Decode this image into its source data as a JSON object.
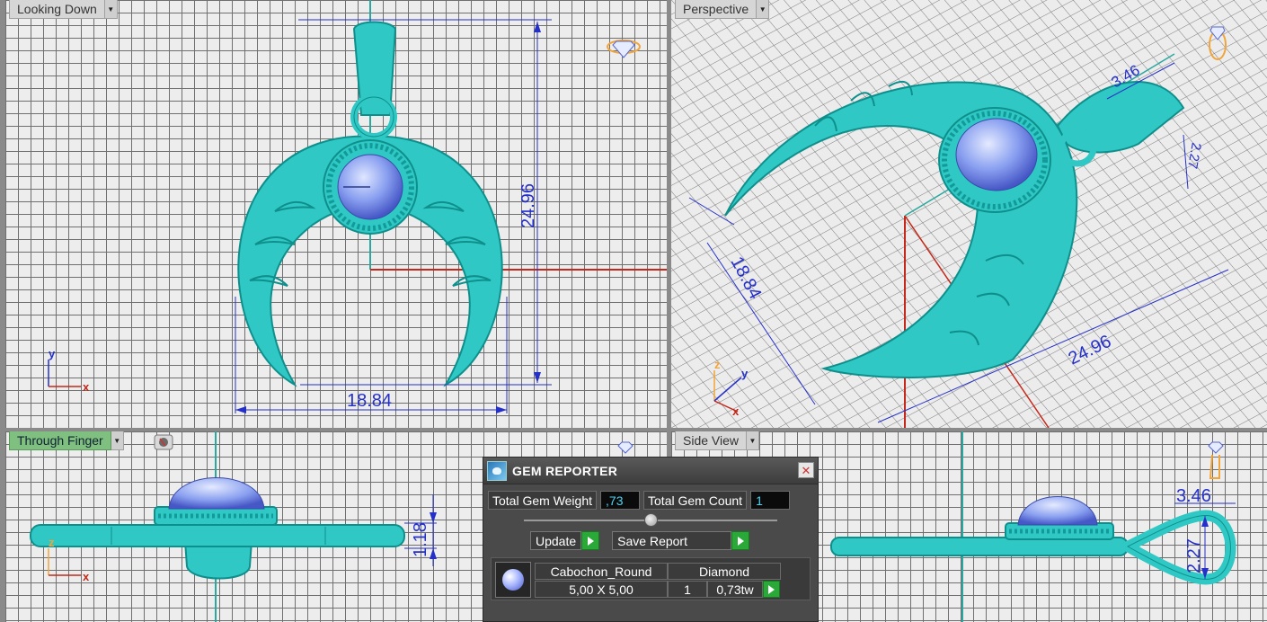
{
  "viewports": {
    "top_left": {
      "label": "Looking Down",
      "dims": [
        "24.96",
        "18.84"
      ]
    },
    "top_right": {
      "label": "Perspective",
      "dims": [
        "18.84",
        "24.96",
        "3.46",
        "2.27"
      ]
    },
    "bottom_left": {
      "label": "Through Finger",
      "dims": [
        "1.18"
      ]
    },
    "bottom_right": {
      "label": "Side View",
      "dims": [
        "3.46",
        "2.27"
      ]
    }
  },
  "axes": {
    "x": "x",
    "y": "y",
    "z": "z"
  },
  "gem_reporter": {
    "title": "GEM REPORTER",
    "total_weight_label": "Total Gem Weight",
    "total_weight_value": ",73",
    "total_count_label": "Total Gem Count",
    "total_count_value": "1",
    "update_label": "Update",
    "save_label": "Save Report",
    "gems": [
      {
        "shape": "Cabochon_Round",
        "size": "5,00 X 5,00",
        "material": "Diamond",
        "count": "1",
        "weight": "0,73tw"
      }
    ]
  },
  "colors": {
    "model": "#2fc8c4",
    "model_dark": "#129a98",
    "gem": "#7f96ee",
    "dimension": "#2530c9",
    "x_axis": "#c4281a",
    "play_button": "#2aa838"
  },
  "icons": [
    "diamond-icon",
    "ring-gem-icon",
    "camera-icon",
    "chevron-down-icon",
    "play-icon",
    "close-icon"
  ]
}
